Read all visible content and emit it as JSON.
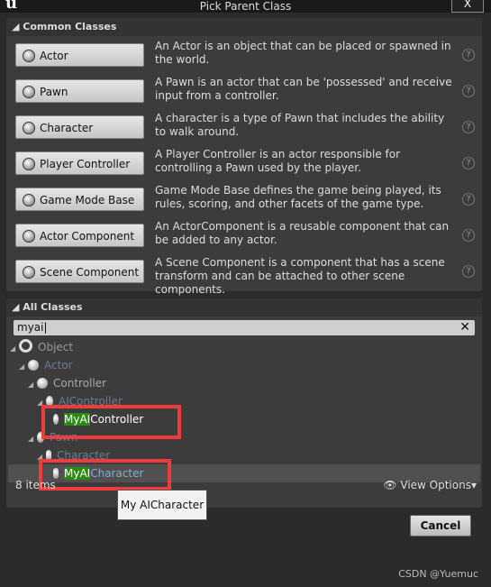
{
  "window": {
    "title": "Pick Parent Class",
    "close": "X",
    "logo": "u"
  },
  "common": {
    "header": "Common Classes",
    "items": [
      {
        "label": "Actor",
        "desc": "An Actor is an object that can be placed or spawned in the world."
      },
      {
        "label": "Pawn",
        "desc": "A Pawn is an actor that can be 'possessed' and receive input from a controller."
      },
      {
        "label": "Character",
        "desc": "A character is a type of Pawn that includes the ability to walk around."
      },
      {
        "label": "Player Controller",
        "desc": "A Player Controller is an actor responsible for controlling a Pawn used by the player."
      },
      {
        "label": "Game Mode Base",
        "desc": "Game Mode Base defines the game being played, its rules, scoring, and other facets of the game type."
      },
      {
        "label": "Actor Component",
        "desc": "An ActorComponent is a reusable component that can be added to any actor."
      },
      {
        "label": "Scene Component",
        "desc": "A Scene Component is a component that has a scene transform and can be attached to other scene components."
      }
    ],
    "help": "?"
  },
  "all": {
    "header": "All Classes",
    "search_value": "myai",
    "clear": "✕",
    "tree": [
      {
        "label": "Object"
      },
      {
        "label": "Actor"
      },
      {
        "label": "Controller"
      },
      {
        "label": "AIController"
      },
      {
        "match": "MyAI",
        "rest": "Controller"
      },
      {
        "label": "Pawn"
      },
      {
        "label": "Character"
      },
      {
        "match": "MyAI",
        "rest": "Character"
      }
    ],
    "count": "8 items",
    "view_options": "View Options"
  },
  "tooltip": "My AICharacter",
  "cancel": "Cancel",
  "watermark": "CSDN @Yuemuc"
}
